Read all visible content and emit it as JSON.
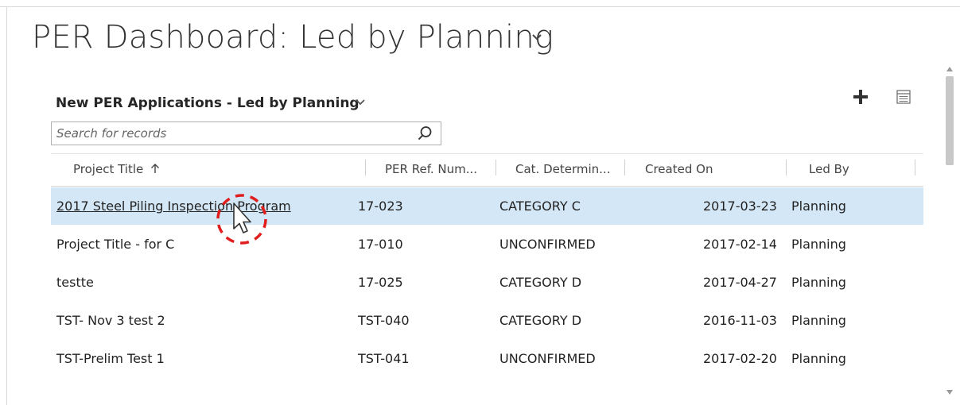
{
  "dashboard": {
    "title": "PER Dashboard: Led by Planning"
  },
  "view": {
    "title": "New PER Applications - Led by Planning"
  },
  "search": {
    "placeholder": "Search for records"
  },
  "columns": [
    {
      "label": "Project Title",
      "sort": "ascending"
    },
    {
      "label": "PER Ref. Num..."
    },
    {
      "label": "Cat. Determin..."
    },
    {
      "label": "Created On"
    },
    {
      "label": "Led By"
    }
  ],
  "rows": [
    {
      "project_title": "2017 Steel Piling Inspection Program",
      "ref": "17-023",
      "category": "CATEGORY C",
      "created": "2017-03-23",
      "led_by": "Planning",
      "selected": true
    },
    {
      "project_title": "Project Title - for C",
      "ref": "17-010",
      "category": "UNCONFIRMED",
      "created": "2017-02-14",
      "led_by": "Planning"
    },
    {
      "project_title": "testte",
      "ref": "17-025",
      "category": "CATEGORY D",
      "created": "2017-04-27",
      "led_by": "Planning"
    },
    {
      "project_title": "TST- Nov 3 test 2",
      "ref": "TST-040",
      "category": "CATEGORY D",
      "created": "2016-11-03",
      "led_by": "Planning"
    },
    {
      "project_title": "TST-Prelim Test 1",
      "ref": "TST-041",
      "category": "UNCONFIRMED",
      "created": "2017-02-20",
      "led_by": "Planning"
    }
  ],
  "icons": {
    "title_dropdown": "chevron-down-icon",
    "view_dropdown": "chevron-down-icon",
    "add": "plus-icon",
    "grid": "grid-view-icon",
    "search": "search-icon",
    "sort": "arrow-up-icon",
    "cursor": "mouse-pointer-icon"
  },
  "colors": {
    "selected_row": "#d4e7f6",
    "cursor_highlight": "#e01e1e"
  }
}
